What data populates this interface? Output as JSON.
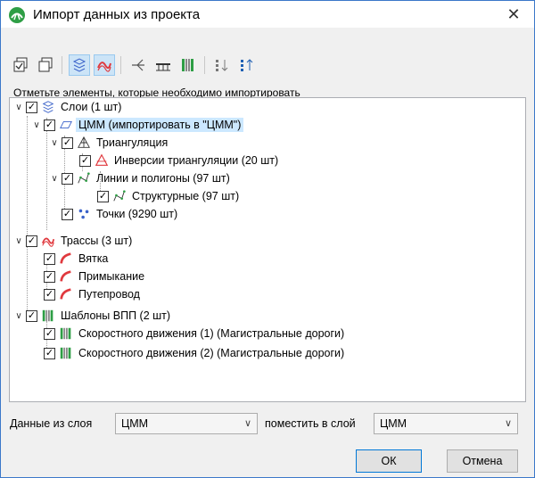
{
  "window": {
    "title": "Импорт данных из проекта",
    "close_glyph": "✕"
  },
  "group_label": "Отметьте элементы, которые необходимо импортировать",
  "tree": {
    "layers": {
      "label": "Слои (1 шт)",
      "checked": true
    },
    "cmm": {
      "label": "ЦММ (импортировать в \"ЦММ\")",
      "checked": true,
      "selected": true
    },
    "triangulation": {
      "label": "Триангуляция",
      "checked": true
    },
    "inversions": {
      "label": "Инверсии триангуляции (20 шт)",
      "checked": true
    },
    "lines": {
      "label": "Линии и полигоны (97 шт)",
      "checked": true
    },
    "structural": {
      "label": "Структурные (97 шт)",
      "checked": true
    },
    "points": {
      "label": "Точки (9290 шт)",
      "checked": true
    },
    "routes": {
      "label": "Трассы (3 шт)",
      "checked": true
    },
    "route_items": [
      {
        "label": "Вятка",
        "checked": true
      },
      {
        "label": "Примыкание",
        "checked": true
      },
      {
        "label": "Путепровод",
        "checked": true
      }
    ],
    "templates": {
      "label": "Шаблоны ВПП (2 шт)",
      "checked": true
    },
    "template_items": [
      {
        "label": "Скоростного движения (1) (Магистральные дороги)",
        "checked": true
      },
      {
        "label": "Скоростного движения (2) (Магистральные дороги)",
        "checked": true
      }
    ]
  },
  "bottom": {
    "source_label": "Данные из слоя",
    "source_value": "ЦММ",
    "target_label": "поместить в слой",
    "target_value": "ЦММ",
    "ok_label": "ОК",
    "cancel_label": "Отмена"
  },
  "icons": {
    "app": "road-app-icon",
    "toolbar": [
      "check-all-icon",
      "uncheck-all-icon",
      "layers-filter-icon",
      "routes-filter-icon",
      "branch-icon",
      "bridge-icon",
      "template-icon",
      "sort-down-icon",
      "sort-up-icon"
    ]
  },
  "colors": {
    "accent": "#0078d7",
    "selection": "#cce8ff",
    "route_red": "#e0393e",
    "template_green": "#2e9e45"
  }
}
